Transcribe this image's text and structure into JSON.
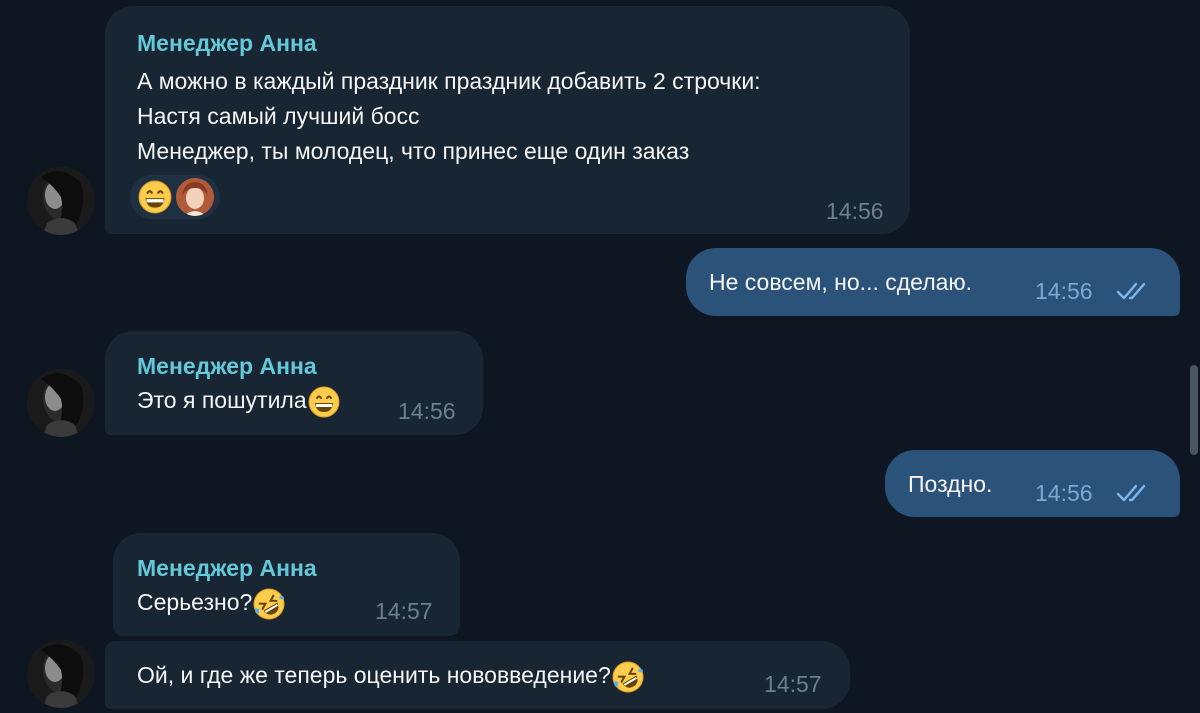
{
  "messages": [
    {
      "sender": "Менеджер Анна",
      "lines": [
        "А можно в каждый праздник праздник добавить 2 строчки:",
        "Настя самый лучший босс",
        "Менеджер, ты молодец, что принес еще один заказ"
      ],
      "time": "14:56",
      "reaction": "grinning-face-emoji"
    },
    {
      "text": "Не совсем, но... сделаю.",
      "time": "14:56",
      "status": "read"
    },
    {
      "sender": "Менеджер Анна",
      "text": "Это я пошутила",
      "emoji": "grinning-face-emoji",
      "time": "14:56"
    },
    {
      "text": "Поздно.",
      "time": "14:56",
      "status": "read"
    },
    {
      "sender": "Менеджер Анна",
      "text": "Серьезно?",
      "emoji": "rolling-on-floor-laughing-emoji",
      "time": "14:57"
    },
    {
      "text": "Ой, и где же теперь оценить нововведение?",
      "emoji": "rolling-on-floor-laughing-emoji",
      "time": "14:57"
    }
  ],
  "colors": {
    "background": "#0e1621",
    "incoming_bubble": "#182533",
    "outgoing_bubble": "#2b5278",
    "sender_name": "#64c8d8",
    "text": "#f5f5f5",
    "time_incoming": "#6d7f8f",
    "time_outgoing": "#7da8d3"
  }
}
